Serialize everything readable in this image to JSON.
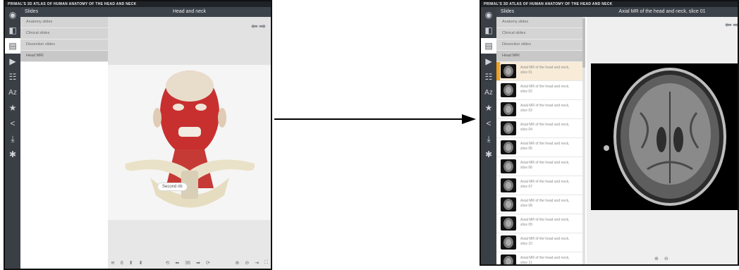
{
  "app_banner": "PRIMAL'S 3D ATLAS OF HUMAN ANATOMY OF THE HEAD AND NECK",
  "slides_label": "Slides",
  "left": {
    "title": "Head and neck",
    "menu": [
      "Anatomy slides",
      "Clinical slides",
      "Dissection slides",
      "Head MRI"
    ],
    "callout": "Second rib",
    "bottom": {
      "layers": "8",
      "page": "36"
    }
  },
  "right": {
    "title": "Axial MR of the head and neck, slice 01",
    "menu": [
      "Anatomy slides",
      "Clinical slides",
      "Dissection slides",
      "Head MRI"
    ],
    "slices": [
      "Axial MR of the head and neck, slice 01",
      "Axial MR of the head and neck, slice 02",
      "Axial MR of the head and neck, slice 03",
      "Axial MR of the head and neck, slice 04",
      "Axial MR of the head and neck, slice 05",
      "Axial MR of the head and neck, slice 06",
      "Axial MR of the head and neck, slice 07",
      "Axial MR of the head and neck, slice 08",
      "Axial MR of the head and neck, slice 09",
      "Axial MR of the head and neck, slice 10",
      "Axial MR of the head and neck, slice 11"
    ]
  },
  "rail_icons": [
    "home-globe-icon",
    "compare-icon",
    "slides-icon",
    "video-icon",
    "tree-icon",
    "az-index-icon",
    "star-icon",
    "share-icon",
    "download-icon",
    "settings-icon"
  ],
  "colors": {
    "rail": "#3a3f46",
    "header": "#3d434a",
    "selected_accent": "#f0a020"
  }
}
